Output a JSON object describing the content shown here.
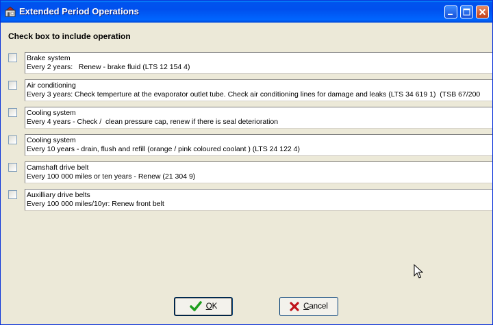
{
  "window": {
    "title": "Extended Period Operations"
  },
  "instruction": "Check box to include operation",
  "operations": [
    {
      "name": "Brake system",
      "description": "Every 2 years:   Renew - brake fluid (LTS 12 154 4)",
      "checked": false
    },
    {
      "name": "Air conditioning",
      "description": "Every 3 years: Check temperture at the evaporator outlet tube. Check air conditioning lines for damage and leaks (LTS 34 619 1)  (TSB 67/200",
      "checked": false
    },
    {
      "name": "Cooling system",
      "description": "Every 4 years - Check /  clean pressure cap, renew if there is seal deterioration",
      "checked": false
    },
    {
      "name": "Cooling system",
      "description": "Every 10 years - drain, flush and refill (orange / pink coloured coolant ) (LTS 24 122 4)",
      "checked": false
    },
    {
      "name": "Camshaft drive belt",
      "description": "Every 100 000 miles or ten years - Renew (21 304 9)",
      "checked": false
    },
    {
      "name": "Auxilliary drive belts",
      "description": "Every 100 000 miles/10yr: Renew front belt",
      "checked": false
    }
  ],
  "buttons": {
    "ok": {
      "label_underlined": "O",
      "label_rest": "K",
      "icon": "check-icon"
    },
    "cancel": {
      "label_underlined": "C",
      "label_rest": "ancel",
      "icon": "x-icon"
    }
  },
  "colors": {
    "titlebar": "#0054e3",
    "window_bg": "#ece9d8",
    "ok_icon": "#1e9e1e",
    "cancel_icon": "#c0141c"
  }
}
